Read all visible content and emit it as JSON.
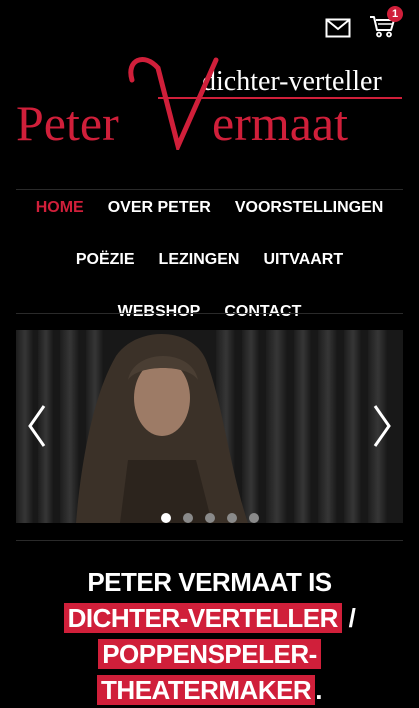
{
  "colors": {
    "accent": "#d01f3a",
    "background": "#000000",
    "text": "#ffffff"
  },
  "header": {
    "mail_icon": "mail-icon",
    "cart_icon": "cart-icon",
    "cart_count": "1"
  },
  "logo": {
    "tagline": "dichter-verteller",
    "name_first": "Peter",
    "name_last": "ermaat"
  },
  "nav": {
    "items": [
      {
        "label": "HOME",
        "active": true
      },
      {
        "label": "OVER PETER"
      },
      {
        "label": "VOORSTELLINGEN"
      },
      {
        "label": "POËZIE"
      },
      {
        "label": "LEZINGEN"
      },
      {
        "label": "UITVAART"
      },
      {
        "label": "WEBSHOP"
      },
      {
        "label": "CONTACT"
      }
    ]
  },
  "slider": {
    "prev_icon": "chevron-left-icon",
    "next_icon": "chevron-right-icon",
    "slide_count": 5,
    "active_slide": 1
  },
  "headline": {
    "line1": "PETER VERMAAT IS",
    "hl1": "DICHTER-VERTELLER",
    "sep": " /",
    "hl2a": "POPPENSPELER-",
    "hl2b": "THEATERMAKER",
    "end": "."
  }
}
